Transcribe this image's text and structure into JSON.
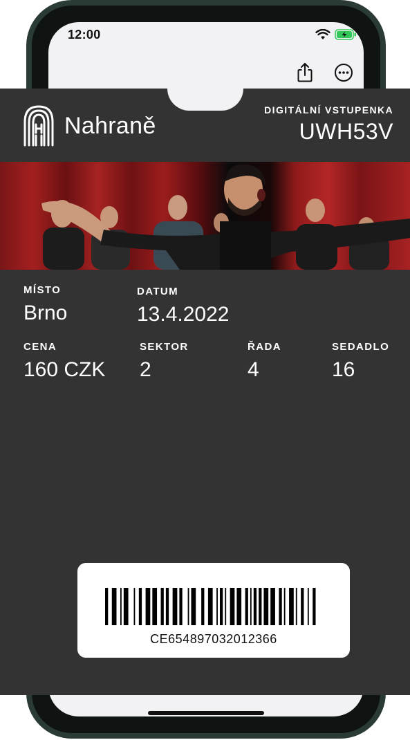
{
  "status_bar": {
    "time": "12:00"
  },
  "ticket": {
    "brand_name": "Nahraně",
    "ticket_type": "DIGITÁLNÍ VSTUPENKA",
    "ticket_code": "UWH53V",
    "fields": {
      "place": {
        "label": "MÍSTO",
        "value": "Brno"
      },
      "date": {
        "label": "DATUM",
        "value": "13.4.2022"
      },
      "price": {
        "label": "CENA",
        "value": "160 CZK"
      },
      "sector": {
        "label": "SEKTOR",
        "value": "2"
      },
      "row": {
        "label": "ŘADA",
        "value": "4"
      },
      "seat": {
        "label": "SEDADLO",
        "value": "16"
      }
    },
    "barcode_number": "CE654897032012366"
  },
  "colors": {
    "ticket_bg": "#333333",
    "frame": "#2a3a35",
    "battery": "#34c759"
  },
  "icons": [
    "wifi-icon",
    "battery-icon",
    "share-icon",
    "more-icon",
    "theatre-logo-icon"
  ]
}
